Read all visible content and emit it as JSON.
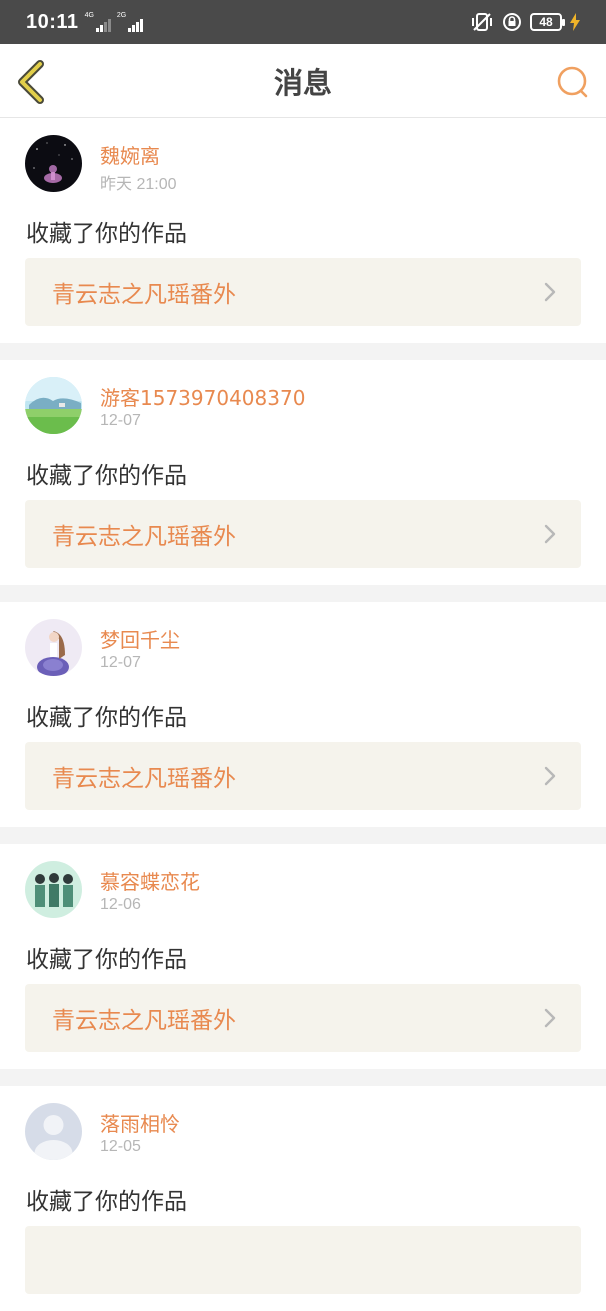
{
  "status_bar": {
    "time": "10:11",
    "net1": "4G",
    "net2": "2G",
    "battery": "48"
  },
  "header": {
    "title": "消息"
  },
  "colors": {
    "accent": "#e8894f",
    "back_icon": "#d8c43a",
    "card_bg": "#f5f3ec",
    "separator": "#f3f3f3"
  },
  "icons": {
    "back": "chevron-left-icon",
    "search": "search-icon",
    "row_arrow": "chevron-right-icon"
  },
  "messages": [
    {
      "username": "魏婉离",
      "date": "昨天 21:00",
      "action": "收藏了你的作品",
      "work_title": "青云志之凡瑶番外"
    },
    {
      "username": "游客1573970408370",
      "date": "12-07",
      "action": "收藏了你的作品",
      "work_title": "青云志之凡瑶番外"
    },
    {
      "username": "梦回千尘",
      "date": "12-07",
      "action": "收藏了你的作品",
      "work_title": "青云志之凡瑶番外"
    },
    {
      "username": "慕容蝶恋花",
      "date": "12-06",
      "action": "收藏了你的作品",
      "work_title": "青云志之凡瑶番外"
    },
    {
      "username": "落雨相怜",
      "date": "12-05",
      "action": "收藏了你的作品",
      "work_title": ""
    }
  ]
}
